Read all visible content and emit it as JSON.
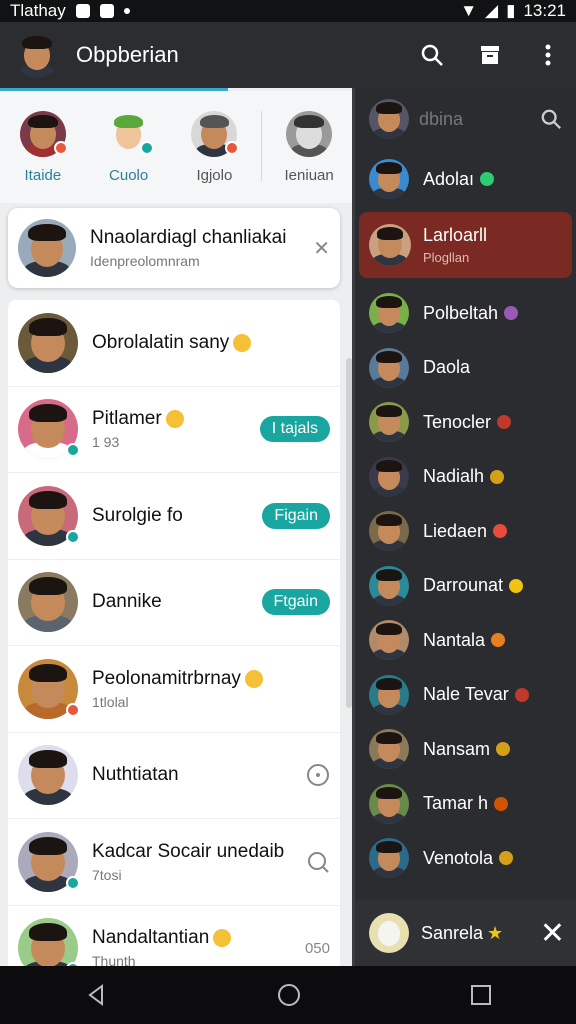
{
  "status_bar": {
    "carrier": "Tlathay",
    "time": "13:21"
  },
  "app_bar": {
    "title": "Obpberian",
    "icons": [
      "search-icon",
      "archive-icon",
      "more-vert-icon"
    ]
  },
  "stories": [
    {
      "label": "Itaide",
      "badge_color": "#e8573c"
    },
    {
      "label": "Cuolo",
      "badge_color": "#1aa6a0"
    },
    {
      "label": "Igjolo",
      "badge_color": "#e8573c"
    },
    {
      "label": "Ieniuan",
      "badge_color": ""
    }
  ],
  "pinned_chat": {
    "name": "Nnaolardiagl chanliakai",
    "subtitle": "Idenpreolomnram"
  },
  "chats": [
    {
      "name": "Obrolalatin sany",
      "subtitle": "",
      "pill": "",
      "trailing": ""
    },
    {
      "name": "Pitlamer",
      "subtitle": "1 93",
      "pill": "I tajals",
      "trailing": ""
    },
    {
      "name": "Surolgie fo",
      "subtitle": "",
      "pill": "Figain",
      "trailing": ""
    },
    {
      "name": "Dannike",
      "subtitle": "",
      "pill": "Ftgain",
      "trailing": ""
    },
    {
      "name": "Peolonamitrbrnay",
      "subtitle": "1tlolal",
      "pill": "",
      "trailing": ""
    },
    {
      "name": "Nuthtiatan",
      "subtitle": "",
      "pill": "",
      "trailing": "clock-icon"
    },
    {
      "name": "Kadcar Socair unedaib",
      "subtitle": "7tosi",
      "pill": "",
      "trailing": "search-icon"
    },
    {
      "name": "Nandaltantian",
      "subtitle": "Thunth",
      "pill": "",
      "trailing": "050"
    }
  ],
  "right_panel": {
    "header": "dbina",
    "top_item": "Adolaı",
    "selected": {
      "name": "Larloarll",
      "subtitle": "Plogllan"
    },
    "items": [
      {
        "name": "Polbeltah",
        "tag_color": "#9b59b6"
      },
      {
        "name": "Daola",
        "tag_color": ""
      },
      {
        "name": "Tenocler",
        "tag_color": "#c0392b"
      },
      {
        "name": "Nadialh",
        "tag_color": "#d4a017"
      },
      {
        "name": "Liedaen",
        "tag_color": "#e74c3c"
      },
      {
        "name": "Darrounat",
        "tag_color": "#f1c40f"
      },
      {
        "name": "Nantala",
        "tag_color": "#e67e22"
      },
      {
        "name": "Nale Tevar",
        "tag_color": "#c0392b"
      },
      {
        "name": "Nansam",
        "tag_color": "#d4a017"
      },
      {
        "name": "Tamar h",
        "tag_color": "#d35400"
      },
      {
        "name": "Venotola",
        "tag_color": "#d4a017"
      }
    ],
    "bottom": {
      "name": "Sanrela"
    }
  }
}
